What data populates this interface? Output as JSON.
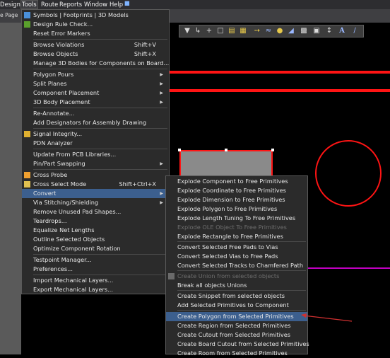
{
  "menubar": {
    "items": [
      "Design",
      "Tools",
      "Route",
      "Reports",
      "Window",
      "Help"
    ]
  },
  "tab": {
    "label": "e Page"
  },
  "tools_menu": {
    "items": [
      {
        "label": "Symbols | Footprints | 3D Models",
        "shortcut": "",
        "arrow": false
      },
      {
        "label": "Design Rule Check...",
        "shortcut": "",
        "arrow": false
      },
      {
        "label": "Reset Error Markers",
        "shortcut": "",
        "arrow": false
      },
      {
        "label": "Browse Violations",
        "shortcut": "Shift+V",
        "arrow": false
      },
      {
        "label": "Browse Objects",
        "shortcut": "Shift+X",
        "arrow": false
      },
      {
        "label": "Manage 3D Bodies for Components on Board...",
        "shortcut": "",
        "arrow": false
      },
      {
        "label": "Polygon Pours",
        "shortcut": "",
        "arrow": true
      },
      {
        "label": "Split Planes",
        "shortcut": "",
        "arrow": true
      },
      {
        "label": "Component Placement",
        "shortcut": "",
        "arrow": true
      },
      {
        "label": "3D Body Placement",
        "shortcut": "",
        "arrow": true
      },
      {
        "label": "Re-Annotate...",
        "shortcut": "",
        "arrow": false
      },
      {
        "label": "Add Designators for Assembly Drawing",
        "shortcut": "",
        "arrow": false
      },
      {
        "label": "Signal Integrity...",
        "shortcut": "",
        "arrow": false
      },
      {
        "label": "PDN Analyzer",
        "shortcut": "",
        "arrow": false
      },
      {
        "label": "Update From PCB Libraries...",
        "shortcut": "",
        "arrow": false
      },
      {
        "label": "Pin/Part Swapping",
        "shortcut": "",
        "arrow": true
      },
      {
        "label": "Cross Probe",
        "shortcut": "",
        "arrow": false
      },
      {
        "label": "Cross Select Mode",
        "shortcut": "Shift+Ctrl+X",
        "arrow": false
      },
      {
        "label": "Convert",
        "shortcut": "",
        "arrow": true
      },
      {
        "label": "Via Stitching/Shielding",
        "shortcut": "",
        "arrow": true
      },
      {
        "label": "Remove Unused Pad Shapes...",
        "shortcut": "",
        "arrow": false
      },
      {
        "label": "Teardrops...",
        "shortcut": "",
        "arrow": false
      },
      {
        "label": "Equalize Net Lengths",
        "shortcut": "",
        "arrow": false
      },
      {
        "label": "Outline Selected Objects",
        "shortcut": "",
        "arrow": false
      },
      {
        "label": "Optimize Component Rotation",
        "shortcut": "",
        "arrow": false
      },
      {
        "label": "Testpoint Manager...",
        "shortcut": "",
        "arrow": false
      },
      {
        "label": "Preferences...",
        "shortcut": "",
        "arrow": false
      },
      {
        "label": "Import Mechanical Layers...",
        "shortcut": "",
        "arrow": false
      },
      {
        "label": "Export Mechanical Layers...",
        "shortcut": "",
        "arrow": false
      }
    ]
  },
  "convert_menu": {
    "items": [
      {
        "label": "Explode Component to Free Primitives",
        "disabled": false
      },
      {
        "label": "Explode Coordinate to Free Primitives",
        "disabled": false
      },
      {
        "label": "Explode Dimension to Free Primitives",
        "disabled": false
      },
      {
        "label": "Explode Polygon to Free Primitives",
        "disabled": false
      },
      {
        "label": "Explode Length Tuning To Free Primitives",
        "disabled": false
      },
      {
        "label": "Explode OLE Object To Free Primitives",
        "disabled": true
      },
      {
        "label": "Explode Rectangle to Free Primitives",
        "disabled": false
      },
      {
        "label": "Convert Selected Free Pads to Vias",
        "disabled": false
      },
      {
        "label": "Convert Selected Vias to Free Pads",
        "disabled": false
      },
      {
        "label": "Convert Selected Tracks to Chamfered Path",
        "disabled": false
      },
      {
        "label": "Create Union from selected objects",
        "disabled": true
      },
      {
        "label": "Break all objects Unions",
        "disabled": false
      },
      {
        "label": "Create Snippet from selected objects",
        "disabled": false
      },
      {
        "label": "Add Selected Primitives to Component",
        "disabled": false
      },
      {
        "label": "Create Polygon from Selected Primitives",
        "disabled": false
      },
      {
        "label": "Create Region from Selected Primitives",
        "disabled": false
      },
      {
        "label": "Create Cutout from Selected Primitives",
        "disabled": false
      },
      {
        "label": "Create Board Cutout from Selected Primitives",
        "disabled": false
      },
      {
        "label": "Create Room from Selected Primitives",
        "disabled": false
      }
    ]
  },
  "colors": {
    "highlight": "#3c5f8e",
    "menu_bg": "#2b2b2b",
    "track_red": "#ff1414",
    "magenta_line": "#c000c0",
    "arrow_annotation": "#d03030"
  }
}
